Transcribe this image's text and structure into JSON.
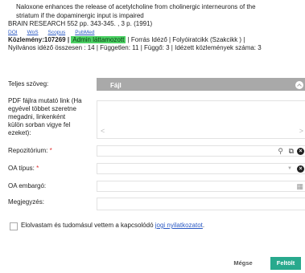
{
  "publication": {
    "title_line1": "Naloxone enhances the release of acetylcholine from cholinergic interneurons of the",
    "title_line2": "striatum if the dopaminergic input is impaired",
    "source": "BRAIN RESEARCH 552 pp. 343-345. , 3 p. (1991)",
    "links": {
      "doi": "DOI",
      "wos": "WoS",
      "scopus": "Scopus",
      "pubmed": "PubMed"
    },
    "record_prefix": "Közlemény:107269 |",
    "status_badge": "Admin láttamozott",
    "record_suffix": "| Forrás Idéző | Folyóiratcikk (Szakcikk ) |",
    "citations": "Nyilvános idéző összesen : 14 | Független: 11 | Függő: 3 | Idézett közlemények száma: 3"
  },
  "form": {
    "full_text_label": "Teljes szöveg:",
    "full_text_value": "Fájl",
    "pdf_link_label_lines": [
      "PDF fájlra mutató link (Ha",
      "egyével többet szeretne",
      "megadni, linkenként",
      "külön sorban vigye fel",
      "ezeket):"
    ],
    "pdf_link_value": "",
    "repository_label": "Repozitórium:",
    "oa_type_label": "OA típus:",
    "oa_embargo_label": "OA embargó:",
    "note_label": "Megjegyzés:",
    "required_mark": "*"
  },
  "consent": {
    "text": "Elolvastam és tudomásul vettem a kapcsolódó ",
    "link": "jogi nyilatkozatot",
    "suffix": "."
  },
  "buttons": {
    "cancel": "Mégse",
    "upload": "Feltölt"
  },
  "icons": {
    "chevron": "chevron-up-icon",
    "search": "search-icon",
    "external": "external-link-icon",
    "clear": "clear-icon",
    "dropdown": "caret-down-icon",
    "calendar": "calendar-icon",
    "scroll_left": "arrow-left-icon",
    "scroll_right": "arrow-right-icon"
  },
  "colors": {
    "accent": "#28a98d",
    "badge": "#4cd164",
    "link": "#2a59c4",
    "select_bg": "#a9a9a9",
    "required": "#e03030"
  }
}
